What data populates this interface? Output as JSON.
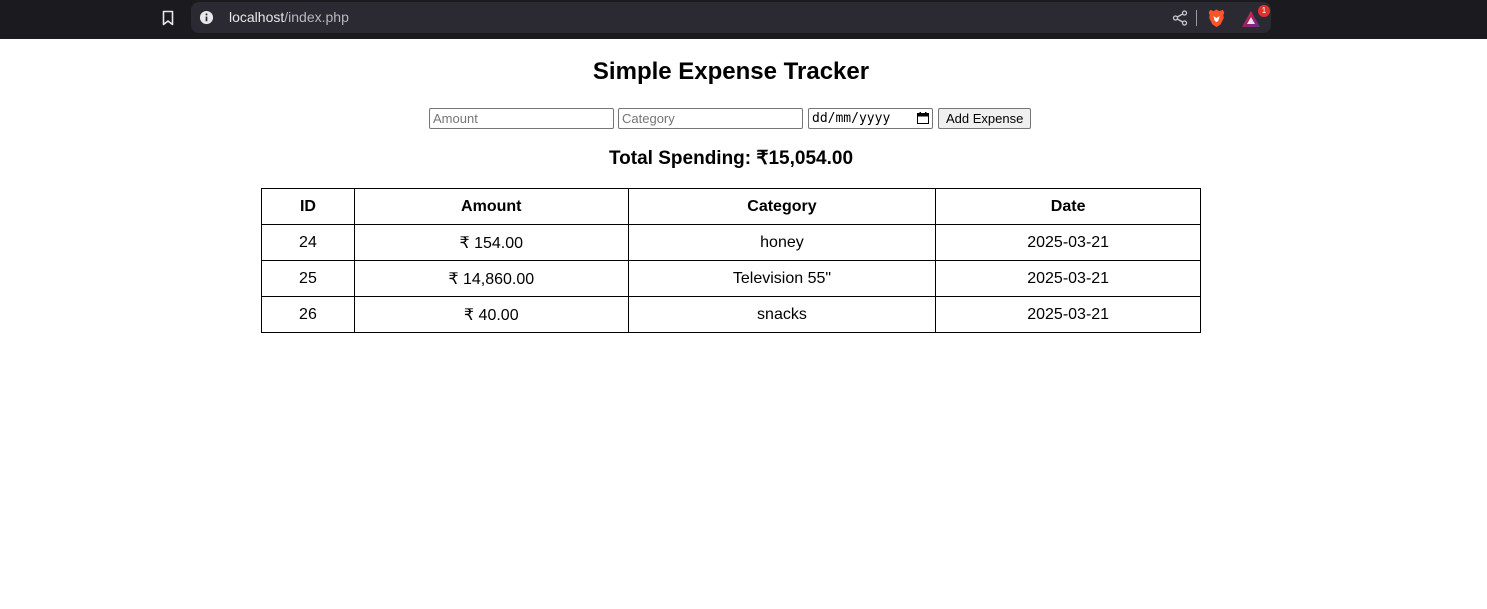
{
  "browser": {
    "url_host": "localhost",
    "url_path": "/index.php",
    "rewards_badge": "1"
  },
  "page": {
    "title": "Simple Expense Tracker",
    "form": {
      "amount_placeholder": "Amount",
      "category_placeholder": "Category",
      "date_placeholder": "dd/mm/yyyy",
      "submit_label": "Add Expense"
    },
    "total_label": "Total Spending: ₹15,054.00",
    "table": {
      "headers": [
        "ID",
        "Amount",
        "Category",
        "Date"
      ],
      "rows": [
        {
          "id": "24",
          "amount": "₹ 154.00",
          "category": "honey",
          "date": "2025-03-21"
        },
        {
          "id": "25",
          "amount": "₹ 14,860.00",
          "category": "Television 55\"",
          "date": "2025-03-21"
        },
        {
          "id": "26",
          "amount": "₹ 40.00",
          "category": "snacks",
          "date": "2025-03-21"
        }
      ]
    }
  },
  "colors": {
    "chrome_bg": "#1b1b1f",
    "omnibox_bg": "#2b2a33",
    "brave_orange": "#fb542b",
    "badge_red": "#e0322d"
  },
  "icons": [
    "bookmark-icon",
    "site-info-icon",
    "share-icon",
    "brave-shields-icon",
    "brave-rewards-icon",
    "calendar-icon"
  ]
}
